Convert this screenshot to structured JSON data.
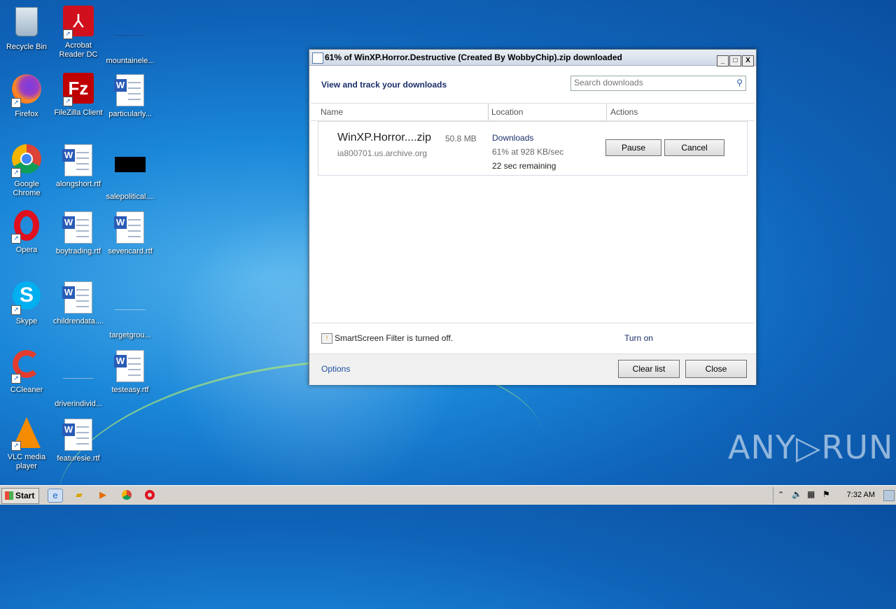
{
  "desktop": {
    "icons": [
      {
        "label": "Recycle Bin",
        "icon": "recycle-bin-icon"
      },
      {
        "label": "Acrobat Reader DC",
        "icon": "acrobat-icon"
      },
      {
        "label": "mountainele...",
        "icon": "blank-file-icon"
      },
      {
        "label": "Firefox",
        "icon": "firefox-icon"
      },
      {
        "label": "FileZilla Client",
        "icon": "filezilla-icon"
      },
      {
        "label": "particularly...",
        "icon": "word-doc-icon"
      },
      {
        "label": "Google Chrome",
        "icon": "chrome-icon"
      },
      {
        "label": "alongshort.rtf",
        "icon": "word-doc-icon"
      },
      {
        "label": "salepolitical....",
        "icon": "black-file-icon"
      },
      {
        "label": "Opera",
        "icon": "opera-icon"
      },
      {
        "label": "boytrading.rtf",
        "icon": "word-doc-icon"
      },
      {
        "label": "sevencard.rtf",
        "icon": "word-doc-icon"
      },
      {
        "label": "Skype",
        "icon": "skype-icon"
      },
      {
        "label": "childrendata....",
        "icon": "word-doc-icon"
      },
      {
        "label": "targetgrou...",
        "icon": "blank-file-icon"
      },
      {
        "label": "CCleaner",
        "icon": "ccleaner-icon"
      },
      {
        "label": "driverindivid...",
        "icon": "blank-file-icon"
      },
      {
        "label": "testeasy.rtf",
        "icon": "word-doc-icon"
      },
      {
        "label": "VLC media player",
        "icon": "vlc-icon"
      },
      {
        "label": "featuresie.rtf",
        "icon": "word-doc-icon"
      }
    ]
  },
  "window": {
    "title": "61% of WinXP.Horror.Destructive  (Created By WobbyChip).zip downloaded",
    "header": "View and track your downloads",
    "search_placeholder": "Search downloads",
    "columns": {
      "name": "Name",
      "location": "Location",
      "actions": "Actions"
    },
    "download": {
      "filename": "WinXP.Horror....zip",
      "size": "50.8 MB",
      "host": "ia800701.us.archive.org",
      "location": "Downloads",
      "progress_text": "61% at 928 KB/sec",
      "remaining": "22 sec remaining",
      "pause_label": "Pause",
      "cancel_label": "Cancel"
    },
    "smartscreen_text": "SmartScreen Filter is turned off.",
    "turn_on_label": "Turn on",
    "options_label": "Options",
    "clear_list_label": "Clear list",
    "close_label": "Close",
    "title_buttons": {
      "minimize": "_",
      "maximize": "□",
      "close": "X"
    }
  },
  "taskbar": {
    "start_label": "Start",
    "clock": "7:32 AM"
  },
  "watermark": "ANY▷RUN"
}
